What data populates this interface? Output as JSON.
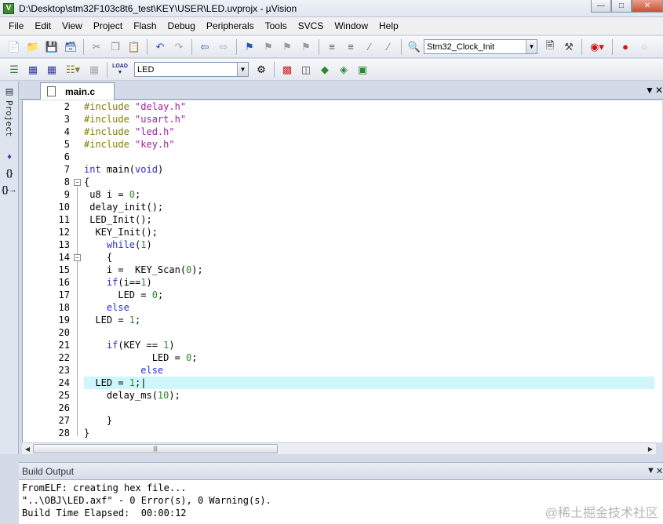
{
  "window": {
    "title": "D:\\Desktop\\stm32F103c8t6_test\\KEY\\USER\\LED.uvprojx - µVision",
    "app_icon_letter": "V"
  },
  "menu": [
    "File",
    "Edit",
    "View",
    "Project",
    "Flash",
    "Debug",
    "Peripherals",
    "Tools",
    "SVCS",
    "Window",
    "Help"
  ],
  "toolbar": {
    "function_combo": "Stm32_Clock_Init",
    "target_combo": "LED",
    "load_label": "LOAD"
  },
  "left_panel": {
    "project_label": "Project"
  },
  "editor": {
    "active_tab": "main.c",
    "current_line": 24,
    "lines": [
      {
        "n": "2"
      },
      {
        "n": "3"
      },
      {
        "n": "4"
      },
      {
        "n": "5"
      },
      {
        "n": "6"
      },
      {
        "n": "7"
      },
      {
        "n": "8"
      },
      {
        "n": "9"
      },
      {
        "n": "10"
      },
      {
        "n": "11"
      },
      {
        "n": "12"
      },
      {
        "n": "13"
      },
      {
        "n": "14"
      },
      {
        "n": "15"
      },
      {
        "n": "16"
      },
      {
        "n": "17"
      },
      {
        "n": "18"
      },
      {
        "n": "19"
      },
      {
        "n": "20"
      },
      {
        "n": "21"
      },
      {
        "n": "22"
      },
      {
        "n": "23"
      },
      {
        "n": "24"
      },
      {
        "n": "25"
      },
      {
        "n": "26"
      },
      {
        "n": "27"
      },
      {
        "n": "28"
      }
    ]
  },
  "build_output": {
    "title": "Build Output",
    "lines": [
      "FromELF: creating hex file...",
      "\"..\\OBJ\\LED.axf\" - 0 Error(s), 0 Warning(s).",
      "Build Time Elapsed:  00:00:12"
    ]
  },
  "watermark": "@稀土掘金技术社区"
}
